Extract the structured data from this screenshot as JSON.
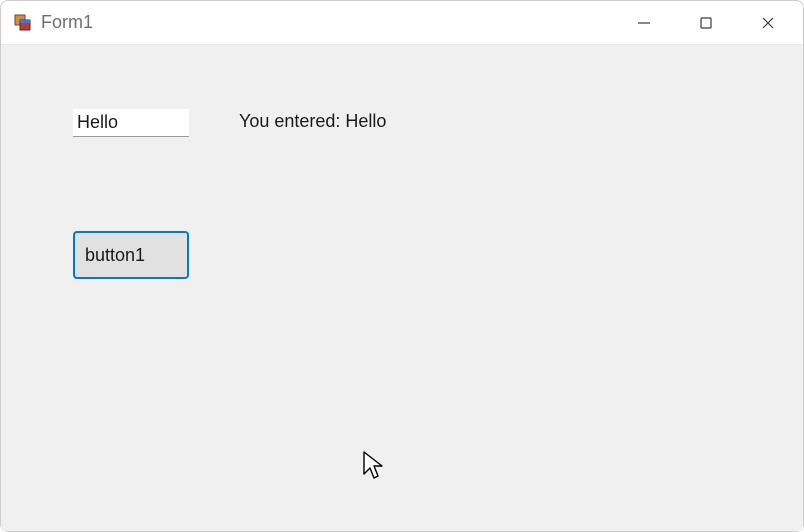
{
  "window": {
    "title": "Form1"
  },
  "form": {
    "textbox_value": "Hello",
    "output_label": "You entered: Hello",
    "button1_label": "button1"
  }
}
